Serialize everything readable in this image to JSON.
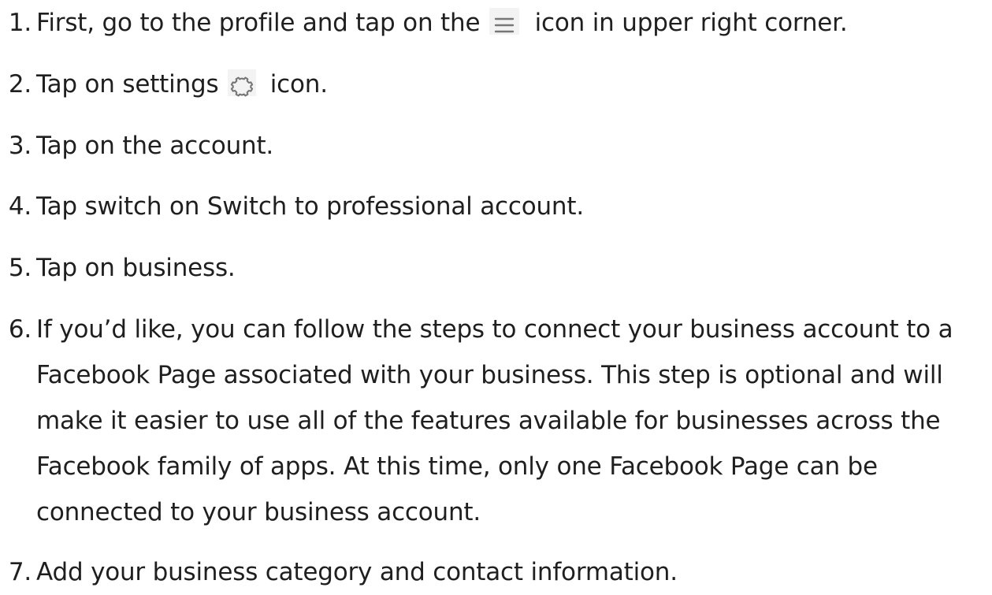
{
  "steps": [
    {
      "number": "1.",
      "before_icon": "First, go to the profile and tap on the",
      "icon": "menu-icon",
      "after_icon": "icon in upper right corner."
    },
    {
      "number": "2.",
      "before_icon": "Tap on settings",
      "icon": "gear-icon",
      "after_icon": "icon."
    },
    {
      "number": "3.",
      "text": "Tap on the account."
    },
    {
      "number": "4.",
      "text": "Tap switch on Switch to professional account."
    },
    {
      "number": "5.",
      "text": "Tap on business."
    },
    {
      "number": "6.",
      "text": "If you’d like, you can follow the steps to connect your business account to a Facebook Page associated with your business. This step is optional and will make it easier to use all of the features available for businesses across the Facebook family of apps. At this time, only one Facebook Page can be connected to your business account."
    },
    {
      "number": "7.",
      "text": "Add your business category and contact information."
    }
  ],
  "colors": {
    "text": "#1f1f1f",
    "icon_background": "#f3f3f3",
    "icon_stroke": "#777777"
  }
}
